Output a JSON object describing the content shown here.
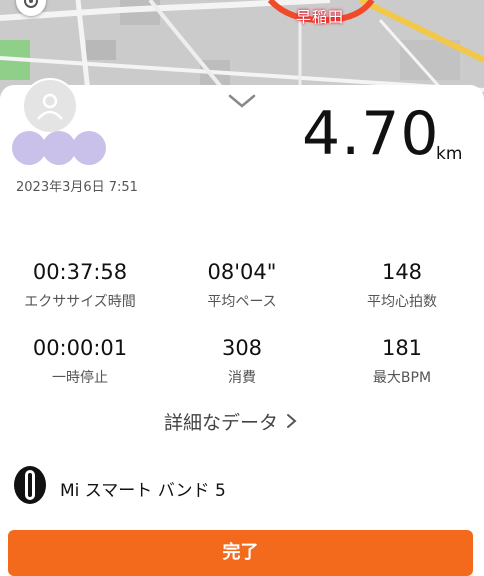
{
  "map": {
    "label": "早稲田",
    "colors": {
      "route": "#f04a2a",
      "road": "#f4f4f4",
      "park": "#8fcf8a",
      "highway": "#f2c84b"
    }
  },
  "sheet": {
    "collapse_icon": "chevron-down-icon",
    "user": {
      "avatar_icon": "user-icon"
    },
    "date": "2023年3月6日 7:51",
    "distance": {
      "value": "4.70",
      "unit": "km"
    },
    "stats": [
      {
        "value": "00:37:58",
        "label": "エクササイズ時間"
      },
      {
        "value": "08'04\"",
        "label": "平均ペース"
      },
      {
        "value": "148",
        "label": "平均心拍数"
      },
      {
        "value": "00:00:01",
        "label": "一時停止"
      },
      {
        "value": "308",
        "label": "消費"
      },
      {
        "value": "181",
        "label": "最大BPM"
      }
    ],
    "details_link": "詳細なデータ",
    "device": {
      "icon": "band-icon",
      "name": "Mi スマート バンド 5"
    },
    "finish_button": "完了",
    "accent_color": "#f36a1d"
  }
}
